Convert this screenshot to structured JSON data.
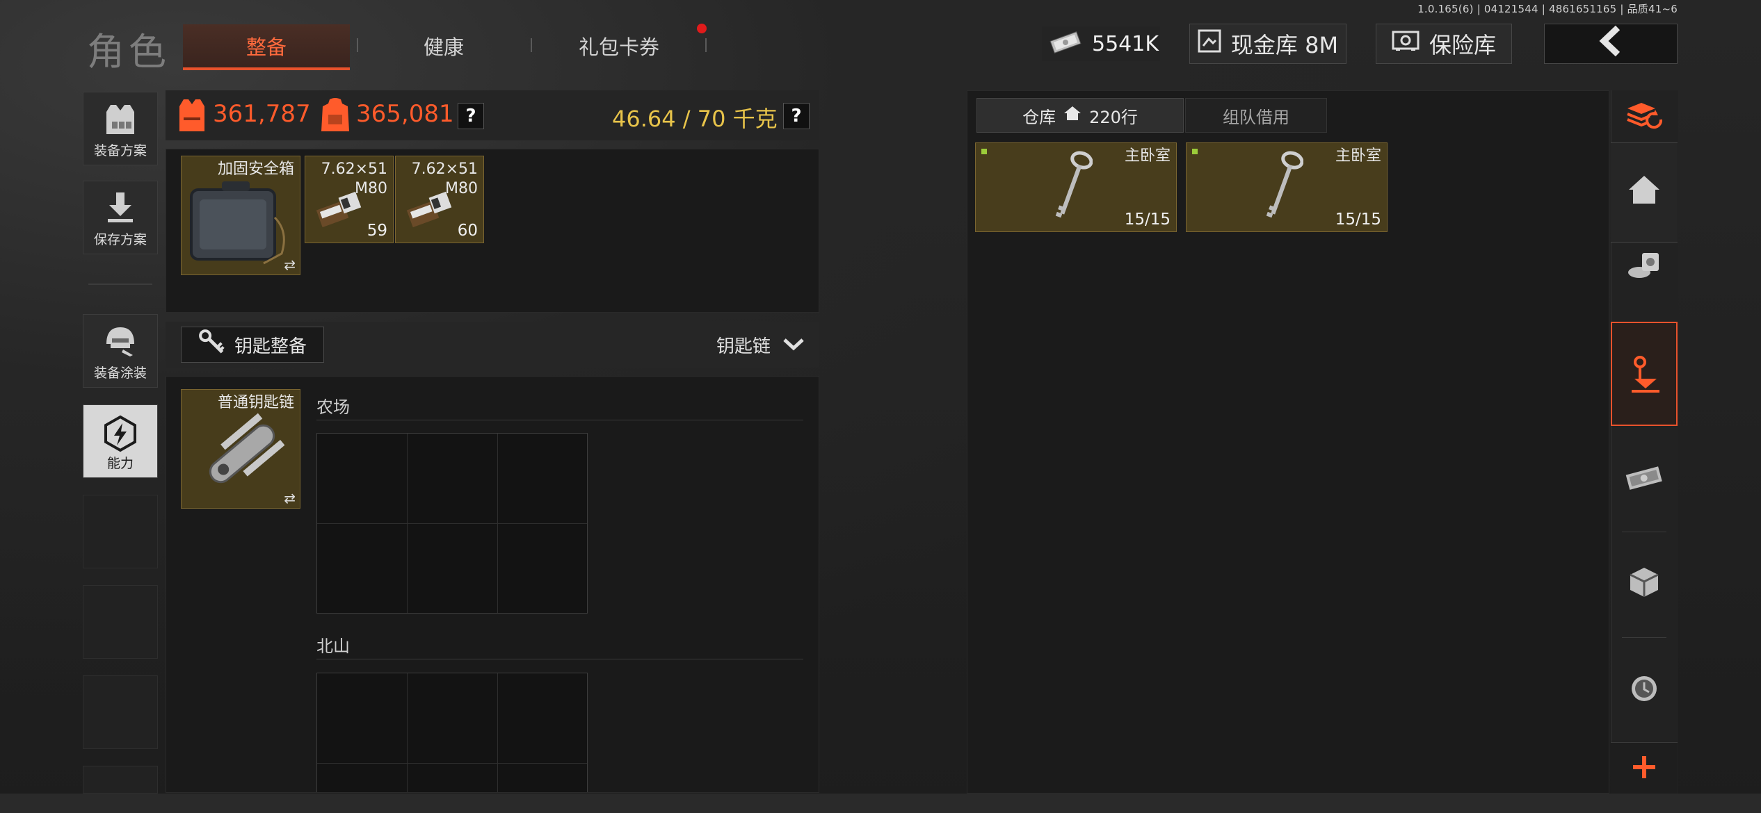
{
  "version": "1.0.165(6) | 04121544 | 4861651165 | 品质41~6",
  "brand": "角色",
  "tabs": [
    "整备",
    "健康",
    "礼包卡券"
  ],
  "currency": {
    "amount": "5541K"
  },
  "cash_vault": {
    "label": "现金库 8M"
  },
  "safe": {
    "label": "保险库"
  },
  "left_nav": {
    "loadout_plan": "装备方案",
    "save_plan": "保存方案",
    "skin": "装备涂装",
    "ability": "能力"
  },
  "stats": {
    "armor_value": "361,787",
    "backpack_value": "365,081",
    "weight": "46.64 / 70 千克",
    "help": "?"
  },
  "secure_case": {
    "label": "加固安全箱",
    "swap": "⇄"
  },
  "ammo": [
    {
      "line1": "7.62×51",
      "line2": "M80",
      "count": "59"
    },
    {
      "line1": "7.62×51",
      "line2": "M80",
      "count": "60"
    }
  ],
  "key_section": {
    "button": "钥匙整备",
    "dropdown": "钥匙链"
  },
  "keychain": {
    "label": "普通钥匙链",
    "swap": "⇄"
  },
  "regions": [
    {
      "name": "农场"
    },
    {
      "name": "北山"
    }
  ],
  "warehouse": {
    "tab_storage": "仓库",
    "tab_rows": "220行",
    "tab_team": "组队借用",
    "items": [
      {
        "label": "主卧室",
        "count": "15/15"
      },
      {
        "label": "主卧室",
        "count": "15/15"
      }
    ]
  },
  "colors": {
    "accent": "#ff5b2b",
    "gold": "#e8c44a",
    "item_bg": "#6e5a1e"
  },
  "icons": {
    "right_nav": [
      "stack-refresh-icon",
      "home-icon",
      "coins-icon",
      "key-download-icon",
      "cash-icon",
      "box-icon",
      "clock-icon",
      "plus-icon"
    ]
  }
}
